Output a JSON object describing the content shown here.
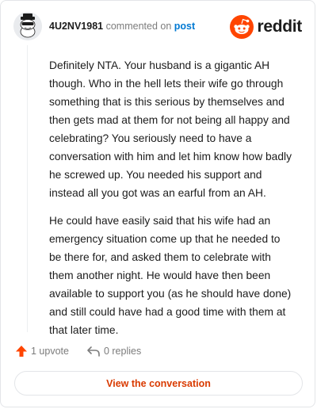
{
  "comment": {
    "username": "4U2NV1981",
    "action_text": "commented on",
    "target_link": "post",
    "paragraphs": [
      "Definitely NTA. Your husband is a gigantic AH though. Who in the hell lets their wife go through something that is this serious by themselves and then gets mad at them for not being all happy and celebrating? You seriously need to have a conversation with him and let him know how badly he screwed up. You needed his support and instead all you got was an earful from an AH.",
      "He could have easily said that his wife had an emergency situation come up that he needed to be there for, and asked them to celebrate with them another night. He would have then been available to support you (as he should have done) and still could have had a good time with them at that later time."
    ]
  },
  "brand": {
    "wordmark": "reddit",
    "icon": "reddit-snoo-icon",
    "color": "#ff4500"
  },
  "actions": {
    "upvote_label": "1 upvote",
    "upvote_icon": "upvote-arrow-icon",
    "replies_label": "0 replies",
    "reply_icon": "reply-arrow-icon"
  },
  "cta": {
    "label": "View the conversation"
  },
  "colors": {
    "accent": "#ff4500",
    "link": "#0079d3",
    "cta_text": "#d93a00",
    "muted": "#7c7c7c"
  }
}
